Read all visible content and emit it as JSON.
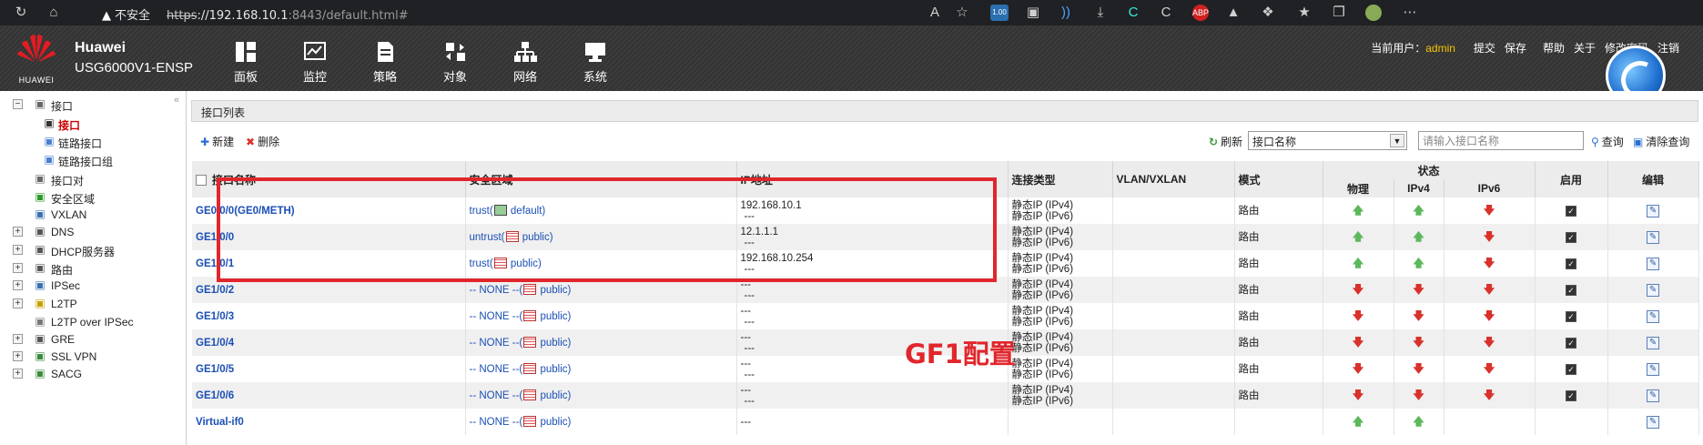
{
  "browser": {
    "warning": "不安全",
    "url_scheme": "https",
    "url_host": "://192.168.10.1",
    "url_rest": ":8443/default.html#",
    "ext_badge": "1.00",
    "ext_abp": "ABP"
  },
  "header": {
    "logo_text": "HUAWEI",
    "brand": "Huawei",
    "model": "USG6000V1-ENSP",
    "nav": [
      "面板",
      "监控",
      "策略",
      "对象",
      "网络",
      "系统"
    ],
    "user_label": "当前用户：",
    "user": "admin",
    "links": [
      "提交",
      "保存",
      "帮助",
      "关于",
      "修改密码",
      "注销"
    ]
  },
  "sidebar": {
    "items": [
      {
        "label": "接口",
        "icon": "interface-icon",
        "expand": "−"
      },
      {
        "label": "接口",
        "icon": "interface-icon",
        "selected": true
      },
      {
        "label": "链路接口",
        "icon": "link-icon"
      },
      {
        "label": "链路接口组",
        "icon": "link-group-icon"
      },
      {
        "label": "接口对",
        "icon": "pair-icon"
      },
      {
        "label": "安全区域",
        "icon": "zone-icon"
      },
      {
        "label": "VXLAN",
        "icon": "vxlan-icon"
      },
      {
        "label": "DNS",
        "icon": "dns-icon",
        "expand": "+"
      },
      {
        "label": "DHCP服务器",
        "icon": "dhcp-icon",
        "expand": "+"
      },
      {
        "label": "路由",
        "icon": "route-icon",
        "expand": "+"
      },
      {
        "label": "IPSec",
        "icon": "ipsec-icon",
        "expand": "+"
      },
      {
        "label": "L2TP",
        "icon": "l2tp-icon",
        "expand": "+"
      },
      {
        "label": "L2TP over IPSec",
        "icon": "l2tp-ipsec-icon"
      },
      {
        "label": "GRE",
        "icon": "gre-icon",
        "expand": "+"
      },
      {
        "label": "SSL VPN",
        "icon": "sslvpn-icon",
        "expand": "+"
      },
      {
        "label": "SACG",
        "icon": "sacg-icon",
        "expand": "+"
      }
    ]
  },
  "panel": {
    "title": "接口列表",
    "new": "新建",
    "delete": "删除",
    "refresh": "刷新",
    "select_value": "接口名称",
    "search_placeholder": "请输入接口名称",
    "query": "查询",
    "clear": "清除查询"
  },
  "columns": {
    "name": "接口名称",
    "zone": "安全区域",
    "ip": "IP地址",
    "conn": "连接类型",
    "vlan": "VLAN/VXLAN",
    "mode": "模式",
    "status": "状态",
    "phys": "物理",
    "ipv4": "IPv4",
    "ipv6": "IPv6",
    "enable": "启用",
    "edit": "编辑"
  },
  "rows": [
    {
      "name": "GE0/0/0(GE0/METH)",
      "zone_pre": "trust(",
      "zone_post": " default)",
      "ip1": "192.168.10.1",
      "ip2": "---",
      "conn1": "静态IP (IPv4)",
      "conn2": "静态IP (IPv6)",
      "mode": "路由",
      "phys": "up",
      "v4": "up",
      "v6": "down",
      "enabled": true
    },
    {
      "name": "GE1/0/0",
      "zone_pre": "untrust(",
      "zone_post": " public)",
      "ip1": "12.1.1.1",
      "ip2": "---",
      "conn1": "静态IP (IPv4)",
      "conn2": "静态IP (IPv6)",
      "mode": "路由",
      "phys": "up",
      "v4": "up",
      "v6": "down",
      "enabled": true
    },
    {
      "name": "GE1/0/1",
      "zone_pre": "trust(",
      "zone_post": " public)",
      "ip1": "192.168.10.254",
      "ip2": "---",
      "conn1": "静态IP (IPv4)",
      "conn2": "静态IP (IPv6)",
      "mode": "路由",
      "phys": "up",
      "v4": "up",
      "v6": "down",
      "enabled": true
    },
    {
      "name": "GE1/0/2",
      "zone_pre": "-- NONE --(",
      "zone_post": " public)",
      "ip1": "---",
      "ip2": "---",
      "conn1": "静态IP (IPv4)",
      "conn2": "静态IP (IPv6)",
      "mode": "路由",
      "phys": "down",
      "v4": "down",
      "v6": "down",
      "enabled": true
    },
    {
      "name": "GE1/0/3",
      "zone_pre": "-- NONE --(",
      "zone_post": " public)",
      "ip1": "---",
      "ip2": "---",
      "conn1": "静态IP (IPv4)",
      "conn2": "静态IP (IPv6)",
      "mode": "路由",
      "phys": "down",
      "v4": "down",
      "v6": "down",
      "enabled": true
    },
    {
      "name": "GE1/0/4",
      "zone_pre": "-- NONE --(",
      "zone_post": " public)",
      "ip1": "---",
      "ip2": "---",
      "conn1": "静态IP (IPv4)",
      "conn2": "静态IP (IPv6)",
      "mode": "路由",
      "phys": "down",
      "v4": "down",
      "v6": "down",
      "enabled": true
    },
    {
      "name": "GE1/0/5",
      "zone_pre": "-- NONE --(",
      "zone_post": " public)",
      "ip1": "---",
      "ip2": "---",
      "conn1": "静态IP (IPv4)",
      "conn2": "静态IP (IPv6)",
      "mode": "路由",
      "phys": "down",
      "v4": "down",
      "v6": "down",
      "enabled": true
    },
    {
      "name": "GE1/0/6",
      "zone_pre": "-- NONE --(",
      "zone_post": " public)",
      "ip1": "---",
      "ip2": "---",
      "conn1": "静态IP (IPv4)",
      "conn2": "静态IP (IPv6)",
      "mode": "路由",
      "phys": "down",
      "v4": "down",
      "v6": "down",
      "enabled": true
    },
    {
      "name": "Virtual-if0",
      "zone_pre": "-- NONE --(",
      "zone_post": " public)",
      "ip1": "---",
      "ip2": "",
      "conn1": "",
      "conn2": "",
      "mode": "",
      "phys": "up",
      "v4": "up",
      "v6": "",
      "enabled": false
    }
  ],
  "annotation": "GF1配置",
  "colors": {
    "annotation": "#e1262b",
    "link": "#1a4fb5",
    "up": "#5cb85c",
    "down": "#d9312b",
    "user": "#f5c400"
  }
}
